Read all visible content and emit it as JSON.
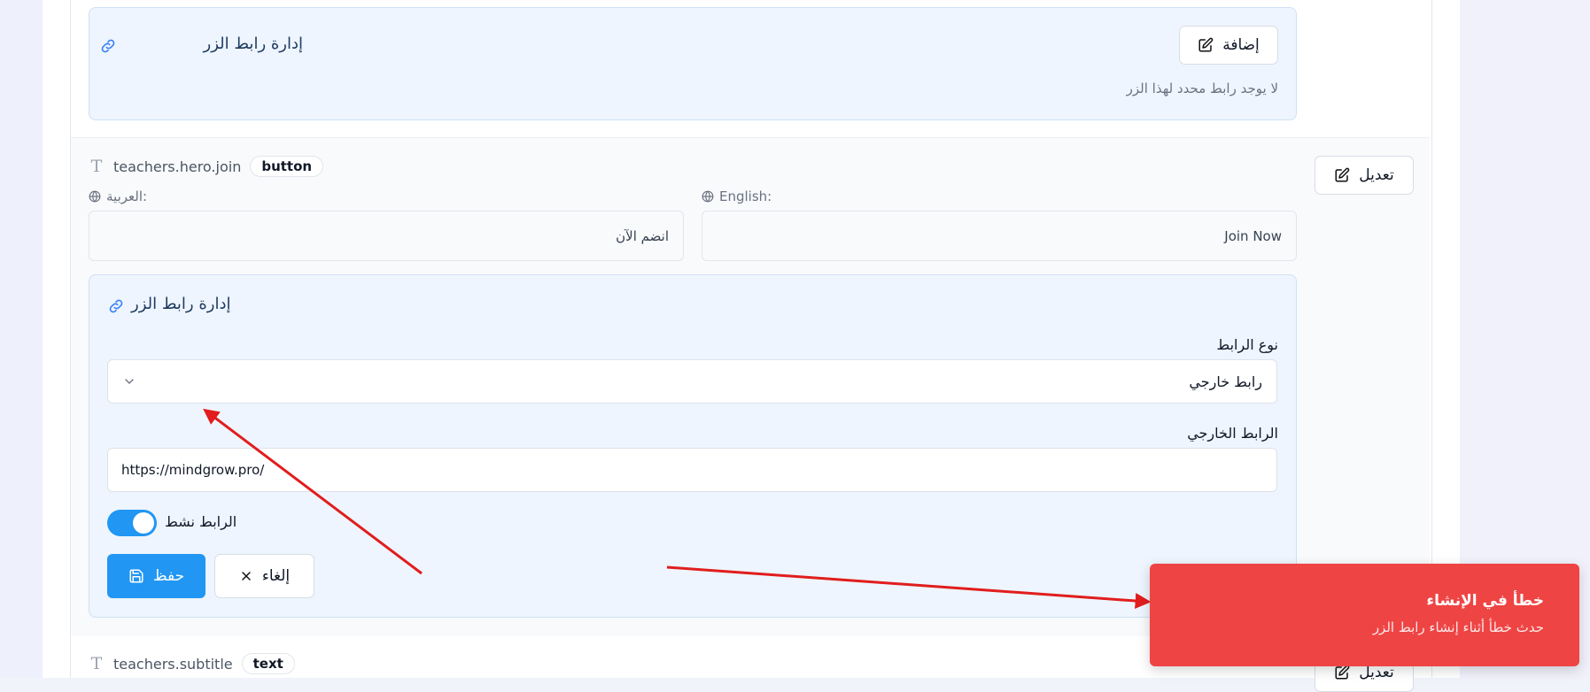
{
  "top_section": {
    "title": "إدارة رابط الزر",
    "add_label": "إضافة",
    "empty_text": "لا يوجد رابط محدد لهذا الزر"
  },
  "item_join": {
    "key": "teachers.hero.join",
    "type": "button",
    "edit_label": "تعديل",
    "arabic_label": "العربية:",
    "arabic_value": "انضم الآن",
    "english_label": "English:",
    "english_value": "Join Now"
  },
  "link_editor": {
    "title": "إدارة رابط الزر",
    "link_type_label": "نوع الرابط",
    "link_type_value": "رابط خارجي",
    "external_url_label": "الرابط الخارجي",
    "external_url_value": "https://mindgrow.pro/",
    "active_label": "الرابط نشط",
    "active": true,
    "cancel_label": "إلغاء",
    "save_label": "حفظ"
  },
  "item_subtitle": {
    "key": "teachers.subtitle",
    "type": "text",
    "edit_label": "تعديل"
  },
  "toast": {
    "title": "خطأ في الإنشاء",
    "description": "حدث خطأ أثناء إنشاء رابط الزر"
  },
  "colors": {
    "primary": "#2196f3",
    "error": "#ef4444",
    "annotation": "#e11d1d"
  }
}
